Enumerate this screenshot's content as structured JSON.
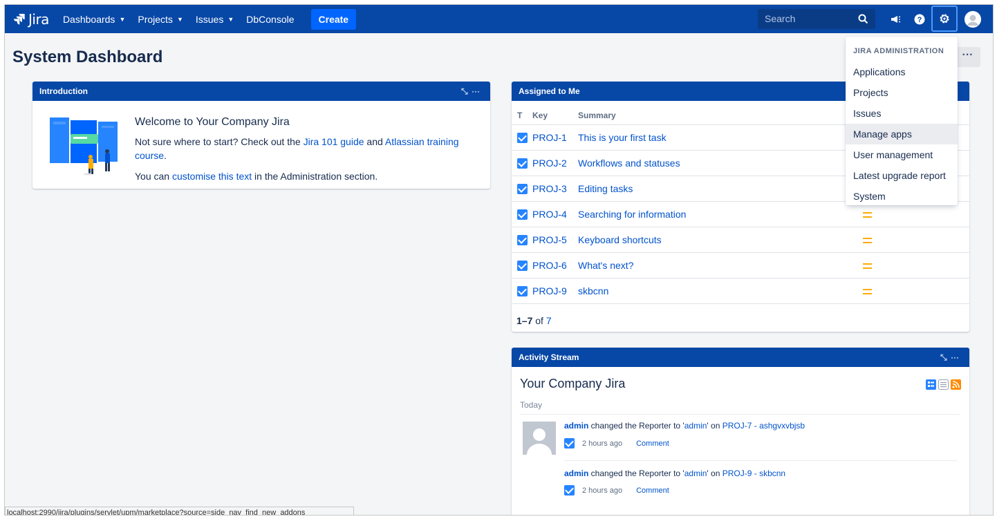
{
  "nav": {
    "logo_text": "Jira",
    "items": [
      {
        "label": "Dashboards",
        "dropdown": true
      },
      {
        "label": "Projects",
        "dropdown": true
      },
      {
        "label": "Issues",
        "dropdown": true
      },
      {
        "label": "DbConsole",
        "dropdown": false
      }
    ],
    "create_label": "Create",
    "search_placeholder": "Search",
    "icons": [
      "megaphone-icon",
      "help-icon",
      "gear-icon",
      "avatar"
    ]
  },
  "page": {
    "title": "System Dashboard",
    "more_label": "···"
  },
  "intro": {
    "header": "Introduction",
    "title": "Welcome to Your Company Jira",
    "line1_pre": "Not sure where to start? Check out the ",
    "link1": "Jira 101 guide",
    "line1_mid": " and ",
    "link2": "Atlassian training course",
    "line1_post": ".",
    "line2_pre": "You can ",
    "link3": "customise this text",
    "line2_post": " in the Administration section."
  },
  "assigned": {
    "header": "Assigned to Me",
    "columns": {
      "type": "T",
      "key": "Key",
      "summary": "Summary"
    },
    "rows": [
      {
        "key": "PROJ-1",
        "summary": "This is your first task"
      },
      {
        "key": "PROJ-2",
        "summary": "Workflows and statuses"
      },
      {
        "key": "PROJ-3",
        "summary": "Editing tasks"
      },
      {
        "key": "PROJ-4",
        "summary": "Searching for information"
      },
      {
        "key": "PROJ-5",
        "summary": "Keyboard shortcuts"
      },
      {
        "key": "PROJ-6",
        "summary": "What's next?"
      },
      {
        "key": "PROJ-9",
        "summary": "skbcnn"
      }
    ],
    "pager_range": "1–7",
    "pager_of": " of ",
    "pager_total": "7"
  },
  "activity": {
    "header": "Activity Stream",
    "title": "Your Company Jira",
    "today": "Today",
    "items": [
      {
        "user": "admin",
        "text_pre": " changed the Reporter to '",
        "value": "admin",
        "text_mid": "' on ",
        "issue": "PROJ-7 - ashgvxvbjsb",
        "time": "2 hours ago",
        "action": "Comment"
      },
      {
        "user": "admin",
        "text_pre": " changed the Reporter to '",
        "value": "admin",
        "text_mid": "' on ",
        "issue": "PROJ-9 - skbcnn",
        "time": "2 hours ago",
        "action": "Comment"
      }
    ]
  },
  "admin_menu": {
    "heading": "JIRA ADMINISTRATION",
    "items": [
      "Applications",
      "Projects",
      "Issues",
      "Manage apps",
      "User management",
      "Latest upgrade report",
      "System"
    ],
    "hovered": "Manage apps"
  },
  "status_url": "localhost:2990/jira/plugins/servlet/upm/marketplace?source=side_nav_find_new_addons",
  "colors": {
    "nav": "#0747a6",
    "link": "#0052cc",
    "create": "#0065ff",
    "priority": "#ffab00"
  }
}
